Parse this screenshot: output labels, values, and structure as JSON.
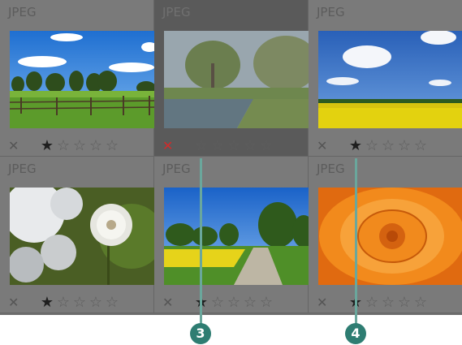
{
  "grid": {
    "cells": [
      {
        "label": "JPEG",
        "stars": 1,
        "rejected": false,
        "selected": false,
        "thumb": "meadow-fence"
      },
      {
        "label": "JPEG",
        "stars": 0,
        "rejected": true,
        "selected": true,
        "thumb": "pond-trees"
      },
      {
        "label": "JPEG",
        "stars": 1,
        "rejected": false,
        "selected": false,
        "thumb": "rapeseed-field"
      },
      {
        "label": "JPEG",
        "stars": 1,
        "rejected": false,
        "selected": false,
        "thumb": "dandelion"
      },
      {
        "label": "JPEG",
        "stars": 1,
        "rejected": false,
        "selected": false,
        "thumb": "country-road"
      },
      {
        "label": "JPEG",
        "stars": 1,
        "rejected": false,
        "selected": false,
        "thumb": "dahlia"
      }
    ],
    "reject_glyph": "✕",
    "star_glyph": "★",
    "empty_star_glyph": "☆",
    "max_stars": 5
  },
  "callouts": [
    {
      "number": "3"
    },
    {
      "number": "4"
    }
  ],
  "colors": {
    "reject_active": "#d12b2b",
    "callout": "#2e7d72"
  }
}
